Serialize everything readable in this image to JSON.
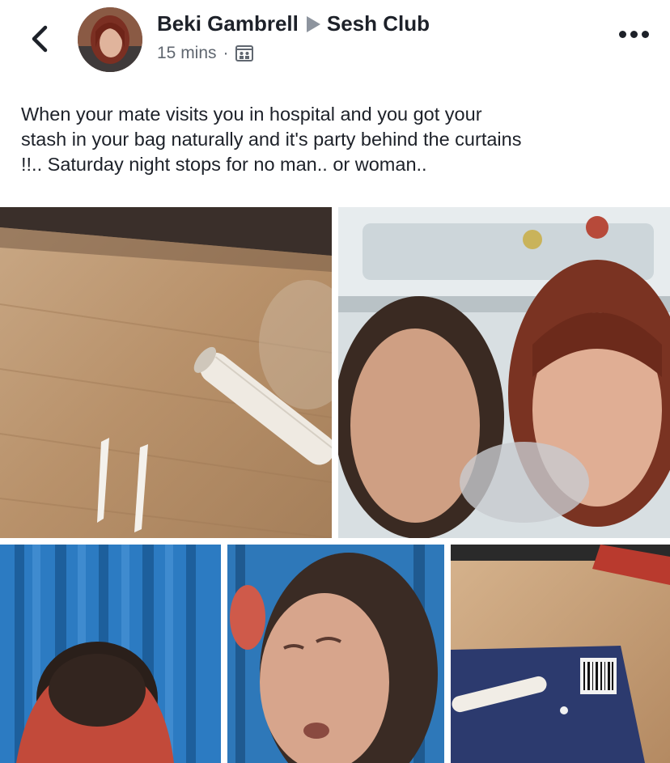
{
  "post": {
    "author": "Beki Gambrell",
    "group": "Sesh Club",
    "time": "15 mins",
    "separator": "·",
    "privacy_icon": "group-privacy-icon",
    "text": "When your mate visits you in hospital and you got your\nstash in your bag naturally and it's party behind the curtains\n!!.. Saturday night stops for no man.. or woman.."
  },
  "icons": {
    "back": "chevron-left-icon",
    "more": "more-options-icon",
    "arrow": "triangle-right-icon"
  },
  "colors": {
    "text": "#1d2129",
    "meta": "#606770",
    "arrow": "#8d949e"
  }
}
